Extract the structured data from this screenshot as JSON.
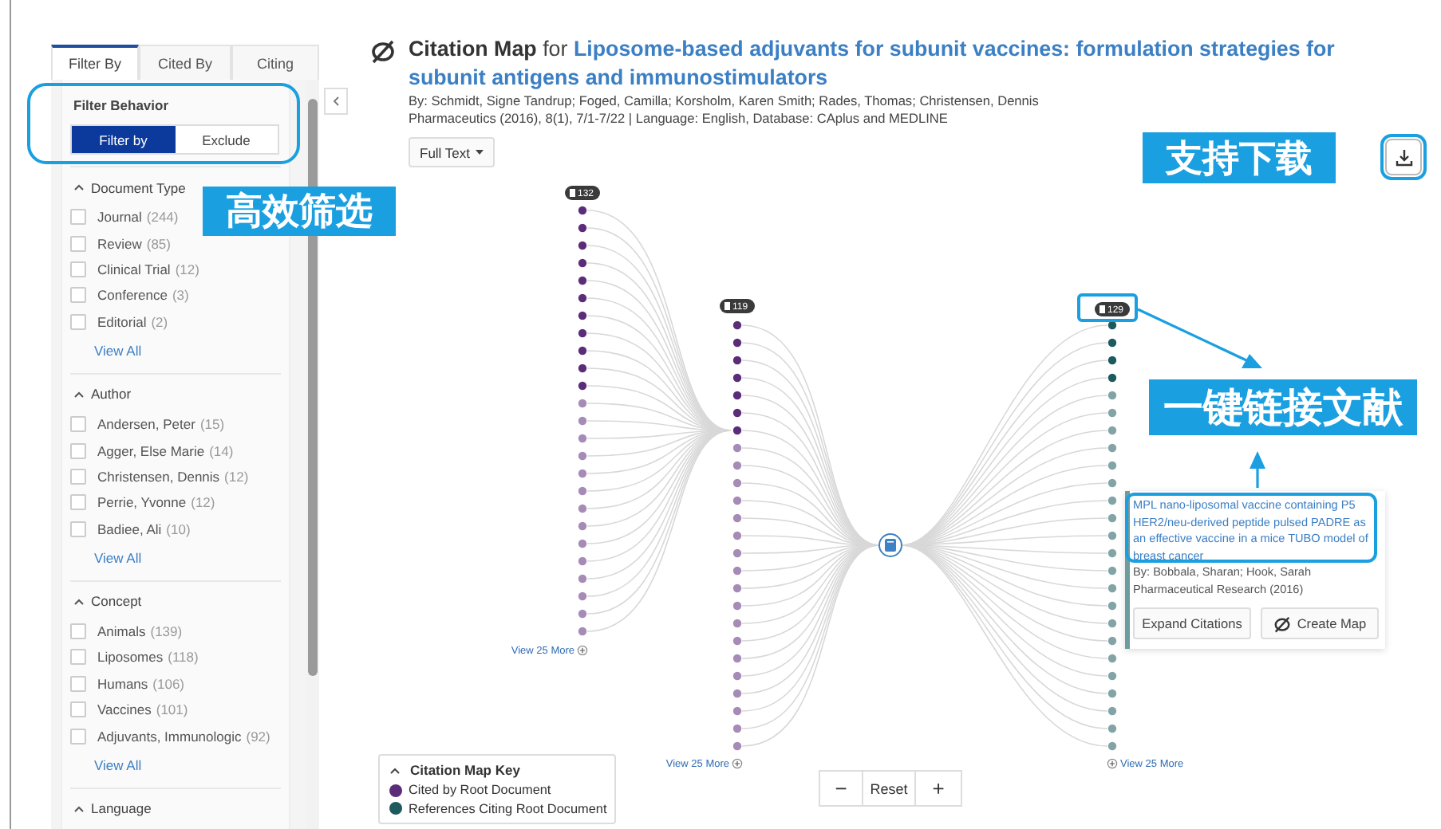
{
  "sidebar": {
    "tabs": [
      {
        "label": "Filter By",
        "selected": true
      },
      {
        "label": "Cited By",
        "selected": false
      },
      {
        "label": "Citing",
        "selected": false
      }
    ],
    "filter_behavior": {
      "title": "Filter Behavior",
      "options": [
        {
          "label": "Filter by",
          "selected": true
        },
        {
          "label": "Exclude",
          "selected": false
        }
      ]
    },
    "sections": [
      {
        "title": "Document Type",
        "expanded": true,
        "items": [
          {
            "label": "Journal",
            "count": "(244)",
            "checked": false
          },
          {
            "label": "Review",
            "count": "(85)",
            "checked": false
          },
          {
            "label": "Clinical Trial",
            "count": "(12)",
            "checked": false
          },
          {
            "label": "Conference",
            "count": "(3)",
            "checked": false
          },
          {
            "label": "Editorial",
            "count": "(2)",
            "checked": false
          }
        ],
        "view_all": "View All"
      },
      {
        "title": "Author",
        "expanded": true,
        "items": [
          {
            "label": "Andersen, Peter",
            "count": "(15)",
            "checked": false
          },
          {
            "label": "Agger, Else Marie",
            "count": "(14)",
            "checked": false
          },
          {
            "label": "Christensen, Dennis",
            "count": "(12)",
            "checked": false
          },
          {
            "label": "Perrie, Yvonne",
            "count": "(12)",
            "checked": false
          },
          {
            "label": "Badiee, Ali",
            "count": "(10)",
            "checked": false
          }
        ],
        "view_all": "View All"
      },
      {
        "title": "Concept",
        "expanded": true,
        "items": [
          {
            "label": "Animals",
            "count": "(139)",
            "checked": false
          },
          {
            "label": "Liposomes",
            "count": "(118)",
            "checked": false
          },
          {
            "label": "Humans",
            "count": "(106)",
            "checked": false
          },
          {
            "label": "Vaccines",
            "count": "(101)",
            "checked": false
          },
          {
            "label": "Adjuvants, Immunologic",
            "count": "(92)",
            "checked": false
          }
        ],
        "view_all": "View All"
      },
      {
        "title": "Language",
        "expanded": true
      }
    ]
  },
  "header": {
    "title": "Citation Map",
    "connector": "for",
    "article_title": "Liposome-based adjuvants for subunit vaccines: formulation strategies for subunit antigens and immunostimulators",
    "byline": "By: Schmidt, Signe Tandrup; Foged, Camilla; Korsholm, Karen Smith; Rades, Thomas; Christensen, Dennis",
    "source": "Pharmaceutics (2016), 8(1), 7/1-7/22 | Language: English, Database: CAplus and MEDLINE",
    "full_text_button": "Full Text"
  },
  "map": {
    "columns": [
      {
        "badge": "132",
        "more": "View 25 More"
      },
      {
        "badge": "119",
        "more": "View 25 More"
      },
      {
        "badge": "129",
        "more": "View 25 More"
      }
    ],
    "popup": {
      "title": "MPL nano-liposomal vaccine containing P5 HER2/neu-derived peptide pulsed PADRE as an effective vaccine in a mice TUBO model of breast cancer",
      "byline": "By: Bobbala, Sharan; Hook, Sarah",
      "source": "Pharmaceutical Research (2016)",
      "buttons": [
        "Expand Citations",
        "Create Map"
      ]
    },
    "zoom": {
      "minus": "−",
      "reset": "Reset",
      "plus": "+"
    }
  },
  "legend": {
    "title": "Citation Map Key",
    "expanded": true,
    "items": [
      {
        "label": "Cited by Root Document",
        "color": "#5b2c7a"
      },
      {
        "label": "References Citing Root Document",
        "color": "#1d5a5e"
      }
    ]
  },
  "annotations": [
    {
      "text": "高效筛选"
    },
    {
      "text": "支持下载"
    },
    {
      "text": "一键链接文献"
    }
  ]
}
